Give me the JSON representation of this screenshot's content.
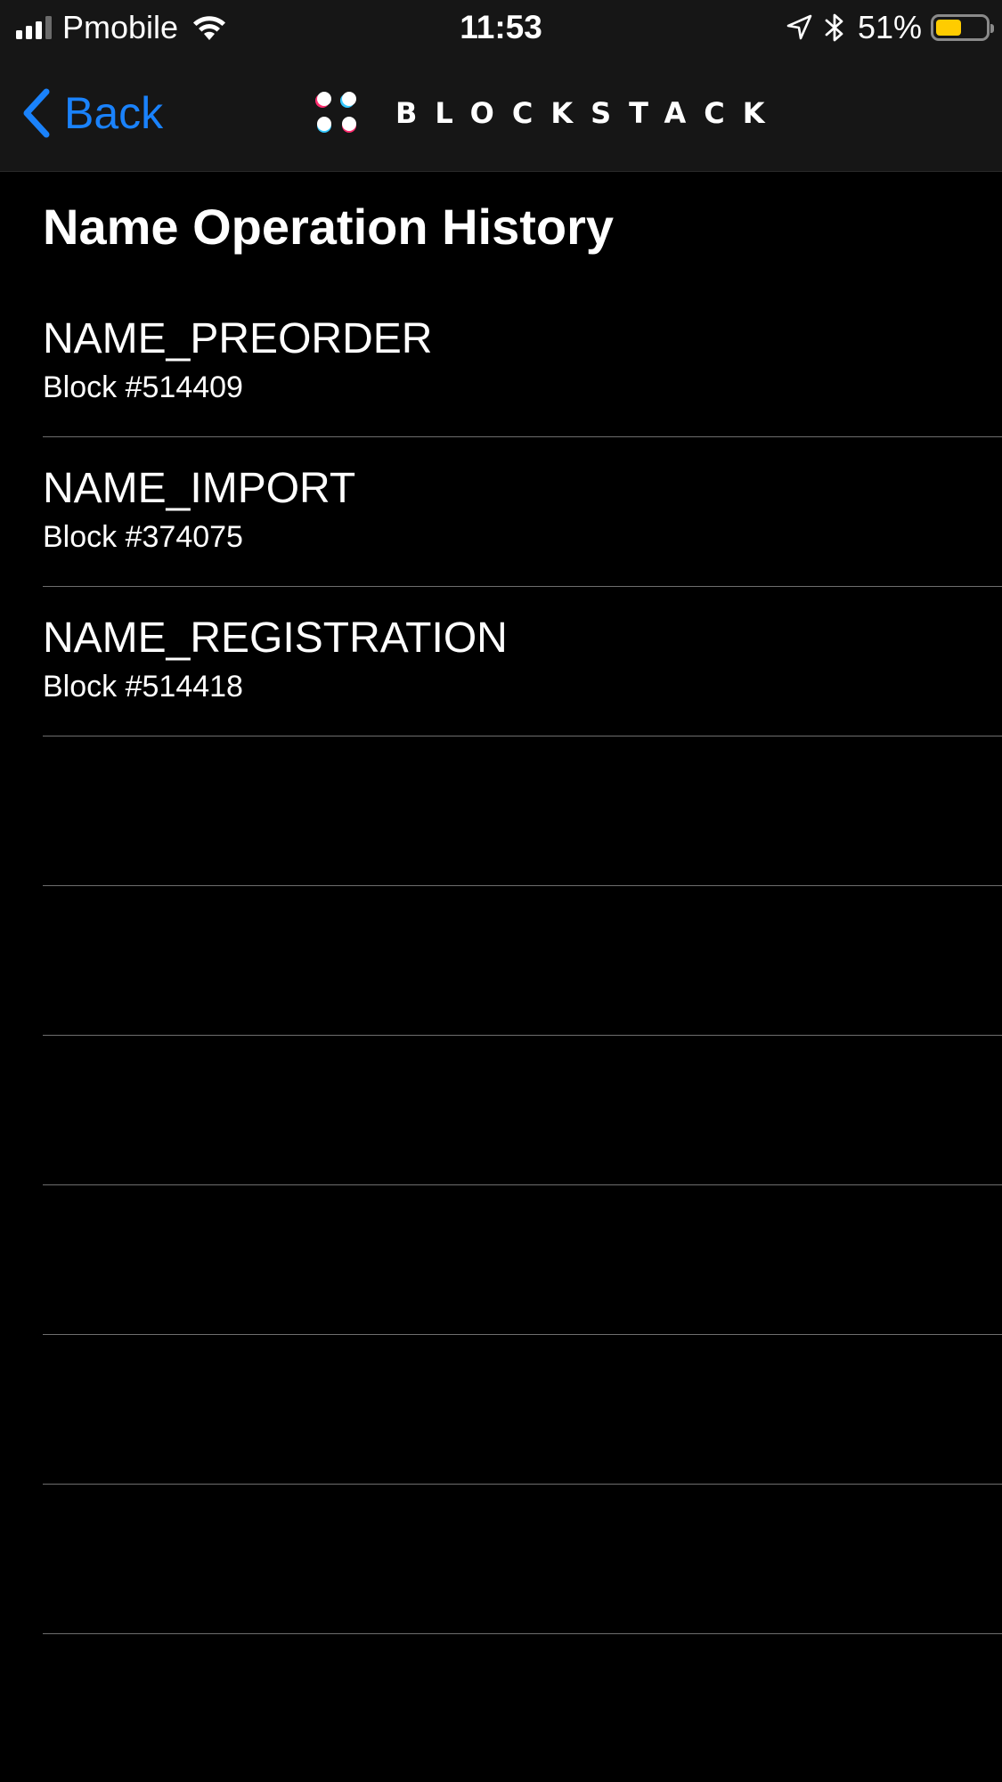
{
  "status_bar": {
    "carrier": "Pmobile",
    "time": "11:53",
    "battery_percent": "51%",
    "battery_level": 0.51,
    "signal_bars": 4,
    "signal_bars_active": 3,
    "icons": [
      "signal-icon",
      "wifi-icon",
      "location-arrow-icon",
      "bluetooth-icon",
      "battery-icon"
    ],
    "battery_color": "#ffcc00"
  },
  "nav": {
    "back_label": "Back",
    "brand_name": "BLOCKSTACK",
    "accent_color": "#1a82fb"
  },
  "page": {
    "title": "Name Operation History"
  },
  "history": {
    "items": [
      {
        "operation": "NAME_PREORDER",
        "block": "Block #514409"
      },
      {
        "operation": "NAME_IMPORT",
        "block": "Block #374075"
      },
      {
        "operation": "NAME_REGISTRATION",
        "block": "Block #514418"
      },
      {
        "operation": "",
        "block": ""
      },
      {
        "operation": "",
        "block": ""
      },
      {
        "operation": "",
        "block": ""
      },
      {
        "operation": "",
        "block": ""
      },
      {
        "operation": "",
        "block": ""
      },
      {
        "operation": "",
        "block": ""
      }
    ]
  }
}
